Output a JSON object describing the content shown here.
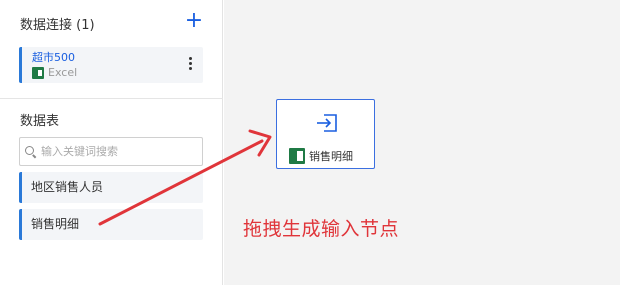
{
  "sidebar": {
    "connections_title": "数据连接 (1)",
    "add_label": "+",
    "connection": {
      "name": "超市500",
      "type": "Excel"
    },
    "tables_title": "数据表",
    "search_placeholder": "输入关键词搜索",
    "tables": [
      {
        "label": "地区销售人员"
      },
      {
        "label": "销售明细"
      }
    ]
  },
  "canvas": {
    "node": {
      "label": "销售明细",
      "icon": "import-icon"
    },
    "annotation": "拖拽生成输入节点"
  },
  "colors": {
    "accent": "#1a5fe0",
    "card_border": "#2a79d8",
    "excel_green": "#1f7a45",
    "annotation": "#e0353a"
  }
}
